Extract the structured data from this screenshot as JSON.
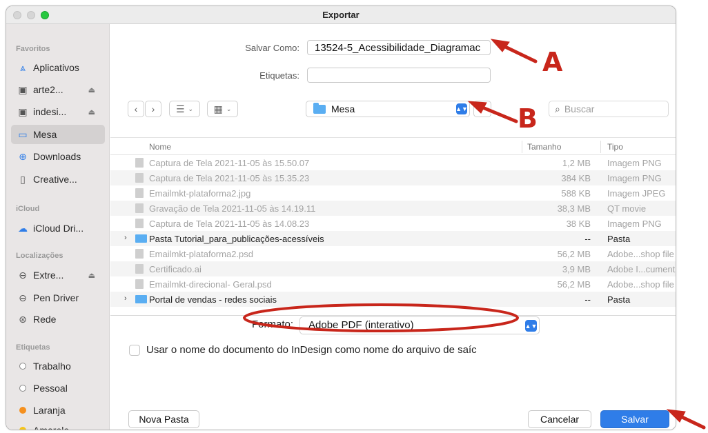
{
  "window": {
    "title": "Exportar"
  },
  "sidebar": {
    "sections": {
      "favorites": "Favoritos",
      "icloud": "iCloud",
      "locations": "Localizações",
      "tags": "Etiquetas"
    },
    "favorites": [
      {
        "label": "Aplicativos",
        "icon": "applications-icon"
      },
      {
        "label": "arte2...",
        "icon": "disk-icon"
      },
      {
        "label": "indesi...",
        "icon": "disk-icon"
      },
      {
        "label": "Mesa",
        "icon": "desktop-icon",
        "selected": true
      },
      {
        "label": "Downloads",
        "icon": "downloads-icon"
      },
      {
        "label": "Creative...",
        "icon": "document-icon"
      }
    ],
    "icloud": [
      {
        "label": "iCloud Dri...",
        "icon": "cloud-icon"
      }
    ],
    "locations": [
      {
        "label": "Extre...",
        "icon": "drive-icon"
      },
      {
        "label": "Pen Driver",
        "icon": "drive-icon"
      },
      {
        "label": "Rede",
        "icon": "network-icon"
      }
    ],
    "tags": [
      {
        "label": "Trabalho",
        "color": "#ffffff"
      },
      {
        "label": "Pessoal",
        "color": "#ffffff"
      },
      {
        "label": "Laranja",
        "color": "#f5901e"
      },
      {
        "label": "Amarelo",
        "color": "#f5c518"
      }
    ]
  },
  "form": {
    "save_as_label": "Salvar Como:",
    "save_as_value": "13524-5_Acessibilidade_Diagramac",
    "tags_label": "Etiquetas:",
    "tags_value": ""
  },
  "toolbar": {
    "back": "‹",
    "forward": "›",
    "list_view": "☰",
    "grid_view": "▦",
    "location": "Mesa",
    "search_placeholder": "Buscar"
  },
  "list": {
    "columns": {
      "name": "Nome",
      "size": "Tamanho",
      "kind": "Tipo"
    },
    "rows": [
      {
        "name": "Captura de Tela 2021-11-05 às 15.50.07",
        "size": "1,2 MB",
        "kind": "Imagem PNG"
      },
      {
        "name": "Captura de Tela 2021-11-05 às 15.35.23",
        "size": "384 KB",
        "kind": "Imagem PNG"
      },
      {
        "name": "Emailmkt-plataforma2.jpg",
        "size": "588 KB",
        "kind": "Imagem JPEG"
      },
      {
        "name": "Gravação de Tela 2021-11-05 às 14.19.11",
        "size": "38,3 MB",
        "kind": "QT movie"
      },
      {
        "name": "Captura de Tela 2021-11-05 às 14.08.23",
        "size": "38 KB",
        "kind": "Imagem PNG"
      },
      {
        "name": "Pasta Tutorial_para_publicações-acessíveis",
        "size": "--",
        "kind": "Pasta",
        "folder": true
      },
      {
        "name": "Emailmkt-plataforma2.psd",
        "size": "56,2 MB",
        "kind": "Adobe...shop file"
      },
      {
        "name": "Certificado.ai",
        "size": "3,9 MB",
        "kind": "Adobe I...cument"
      },
      {
        "name": "Emailmkt-direcional- Geral.psd",
        "size": "56,2 MB",
        "kind": "Adobe...shop file"
      },
      {
        "name": "Portal de vendas - redes sociais",
        "size": "--",
        "kind": "Pasta",
        "folder": true
      }
    ]
  },
  "format": {
    "label": "Formato:",
    "value": "Adobe PDF (interativo)"
  },
  "option": {
    "use_doc_name": "Usar o nome do documento do InDesign como nome do arquivo de saíc"
  },
  "buttons": {
    "new_folder": "Nova Pasta",
    "cancel": "Cancelar",
    "save": "Salvar"
  },
  "annotations": {
    "a": "A",
    "b": "B",
    "color": "#c8261b"
  }
}
